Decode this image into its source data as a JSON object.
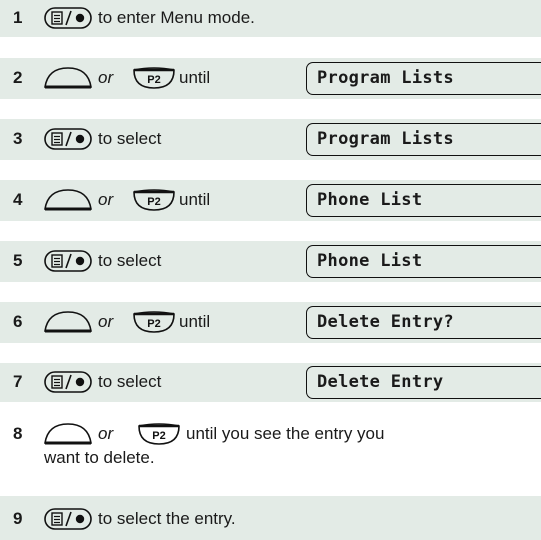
{
  "steps": [
    {
      "number": "1",
      "text": "to enter Menu mode."
    },
    {
      "number": "2",
      "or": "or",
      "text": "until",
      "display": "Program Lists"
    },
    {
      "number": "3",
      "text": "to select",
      "display": "Program Lists"
    },
    {
      "number": "4",
      "or": "or",
      "text": "until",
      "display": "Phone List"
    },
    {
      "number": "5",
      "text": "to select",
      "display": "Phone List"
    },
    {
      "number": "6",
      "or": "or",
      "text": "until",
      "display": "Delete Entry?"
    },
    {
      "number": "7",
      "text": "to select",
      "display": "Delete Entry"
    },
    {
      "number": "8",
      "or": "or",
      "text": "until you see the entry you",
      "text2": "want to delete."
    },
    {
      "number": "9",
      "text": "to select the entry."
    }
  ],
  "icons": {
    "menu_select": "menu-select-key-icon",
    "scroll_up": "scroll-up-key-icon",
    "p2": "p2-key-icon",
    "p2_label": "P2"
  },
  "colors": {
    "row_background": "#e3ebe6",
    "text": "#1a1a1a"
  }
}
